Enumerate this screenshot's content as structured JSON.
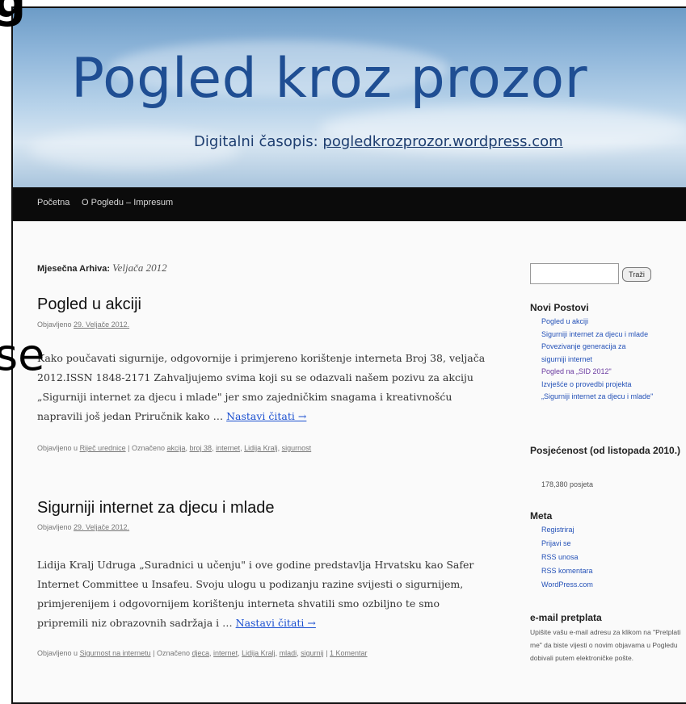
{
  "header": {
    "title": "Pogled kroz prozor",
    "tagline_prefix": "Digitalni časopis: ",
    "tagline_url": "pogledkrozprozor.wordpress.com"
  },
  "nav": {
    "items": [
      "Početna",
      "O Pogledu – Impresum"
    ]
  },
  "archive": {
    "label": "Mjesečna Arhiva:",
    "value": "Veljača 2012"
  },
  "posts": [
    {
      "title": "Pogled u akciji",
      "meta_prefix": "Objavljeno",
      "date": "29. Veljače 2012.",
      "body": "Kako poučavati sigurnije, odgovornije i primjereno korištenje interneta Broj 38, veljača 2012.ISSN 1848-2171 Zahvaljujemo svima koji su se odazvali našem pozivu za akciju „Sigurniji internet za djecu i mlade\" jer smo zajedničkim snagama i kreativnošću napravili još jedan Priručnik kako …",
      "more": "Nastavi čitati →",
      "foot_prefix": "Objavljeno u",
      "category": "Riječ urednice",
      "tags_label": "Označeno",
      "tags": [
        "akcija",
        "broj 38",
        "internet",
        "Lidija Kralj",
        "sigurnost"
      ]
    },
    {
      "title": "Sigurniji internet za djecu i mlade",
      "meta_prefix": "Objavljeno",
      "date": "29. Veljače 2012.",
      "body": "Lidija Kralj Udruga „Suradnici u učenju\" i ove godine predstavlja Hrvatsku kao Safer Internet Committee u Insafeu. Svoju ulogu u podizanju razine svijesti o sigurnijem, primjerenijem i odgovornijem korištenju interneta shvatili smo ozbiljno te smo pripremili niz obrazovnih sadržaja i …",
      "more": "Nastavi čitati →",
      "foot_prefix": "Objavljeno u",
      "category": "Sigurnost na internetu",
      "tags_label": "Označeno",
      "tags": [
        "djeca",
        "internet",
        "Lidija Kralj",
        "mladi",
        "sigurnij"
      ],
      "comments": "1 Komentar"
    }
  ],
  "sidebar": {
    "search_button": "Traži",
    "recent_title": "Novi Postovi",
    "recent": [
      "Pogled u akciji",
      "Sigurniji internet za djecu i mlade",
      "Povezivanje generacija za",
      "sigurniji internet",
      "Pogled na „SID 2012\"",
      "Izvješće o provedbi projekta",
      "„Sigurniji internet za djecu i mlade\""
    ],
    "visits_title": "Posjećenost (od listopada 2010.)",
    "visits_value": "178,380 posjeta",
    "meta_title": "Meta",
    "meta_links": [
      "Registriraj",
      "Prijavi se",
      "RSS unosa",
      "RSS komentara",
      "WordPress.com"
    ],
    "email_title": "e-mail pretplata",
    "email_text": "Upišite vašu e-mail adresu za klikom na \"Pretplati me\" da biste vijesti o novim objavama u Pogledu dobivali putem elektroničke pošte."
  },
  "overlay": {
    "top": "g",
    "left": "se"
  }
}
